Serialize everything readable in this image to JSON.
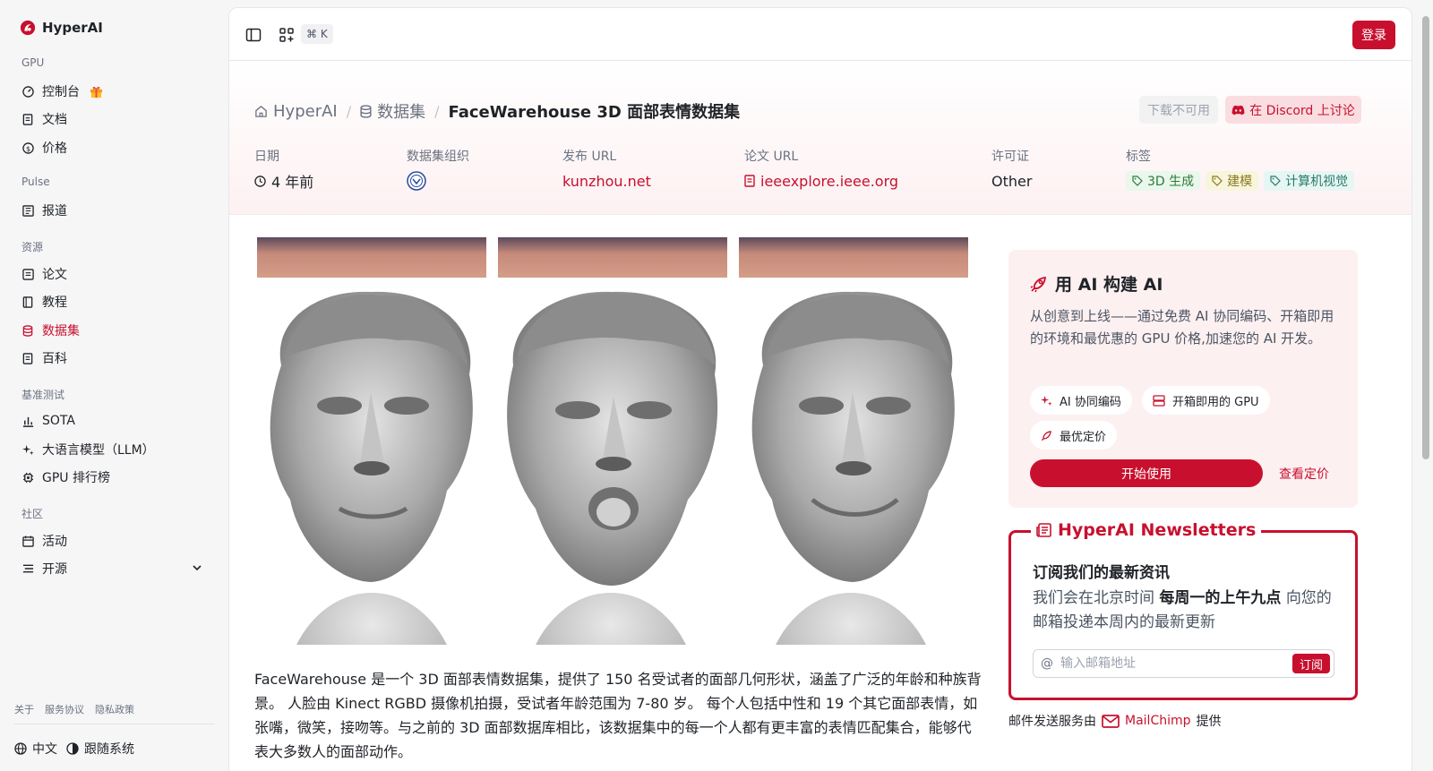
{
  "brand": {
    "name": "HyperAI"
  },
  "sidebar": {
    "sections": [
      "GPU",
      "Pulse",
      "资源",
      "基准测试",
      "社区"
    ],
    "gpu": [
      {
        "label": "控制台",
        "icon": "gauge-icon"
      },
      {
        "label": "文档",
        "icon": "doc-icon"
      },
      {
        "label": "价格",
        "icon": "dollar-icon"
      }
    ],
    "pulse": [
      {
        "label": "报道",
        "icon": "news-icon"
      }
    ],
    "resources": [
      {
        "label": "论文",
        "icon": "paper-icon"
      },
      {
        "label": "教程",
        "icon": "book-icon"
      },
      {
        "label": "数据集",
        "icon": "database-icon"
      },
      {
        "label": "百科",
        "icon": "wiki-icon"
      }
    ],
    "benchmarks": [
      {
        "label": "SOTA",
        "icon": "chart-icon"
      },
      {
        "label": "大语言模型（LLM）",
        "icon": "sparkle-icon"
      },
      {
        "label": "GPU 排行榜",
        "icon": "chip-icon"
      }
    ],
    "community": [
      {
        "label": "活动",
        "icon": "calendar-icon"
      },
      {
        "label": "开源",
        "icon": "list-icon"
      }
    ],
    "footer_links": [
      "关于",
      "服务协议",
      "隐私政策"
    ],
    "language": "中文",
    "theme": "跟随系统"
  },
  "topbar": {
    "shortcut": "⌘ K",
    "login": "登录"
  },
  "breadcrumb": {
    "home": "HyperAI",
    "datasets": "数据集",
    "current": "FaceWarehouse 3D 面部表情数据集"
  },
  "actions": {
    "download": "下载不可用",
    "discord": "在 Discord 上讨论"
  },
  "meta": {
    "date_label": "日期",
    "date_value": "4 年前",
    "org_label": "数据集组织",
    "publish_label": "发布 URL",
    "publish_value": "kunzhou.net",
    "paper_label": "论文 URL",
    "paper_value": "ieeexplore.ieee.org",
    "license_label": "许可证",
    "license_value": "Other",
    "tags_label": "标签",
    "tags": [
      "3D 生成",
      "建模",
      "计算机视觉"
    ]
  },
  "description": "FaceWarehouse 是一个 3D 面部表情数据集，提供了 150 名受试者的面部几何形状，涵盖了广泛的年龄和种族背景。 人脸由 Kinect RGBD 摄像机拍摄，受试者年龄范围为 7-80 岁。 每个人包括中性和 19 个其它面部表情，如张嘴，微笑，接吻等。与之前的 3D 面部数据库相比，该数据集中的每一个人都有更丰富的表情匹配集合，能够代表大多数人的面部动作。",
  "ai_card": {
    "title": "用 AI 构建 AI",
    "desc": "从创意到上线——通过免费 AI 协同编码、开箱即用的环境和最优惠的 GPU 价格,加速您的 AI 开发。",
    "pills": [
      "AI 协同编码",
      "开箱即用的 GPU",
      "最优定价"
    ],
    "start": "开始使用",
    "pricing": "查看定价"
  },
  "newsletter": {
    "title": "HyperAI Newsletters",
    "subtitle": "订阅我们的最新资讯",
    "desc_pre": "我们会在北京时间",
    "desc_bold": "每周一的上午九点",
    "desc_post": "向您的邮箱投递本周内的最新更新",
    "placeholder": "输入邮箱地址",
    "subscribe": "订阅",
    "provider_pre": "邮件发送服务由",
    "provider": "MailChimp",
    "provider_post": "提供"
  },
  "colors": {
    "accent": "#c8102e",
    "hero_bg": "#fdf1f2",
    "card_bg": "#fdf0f1"
  }
}
